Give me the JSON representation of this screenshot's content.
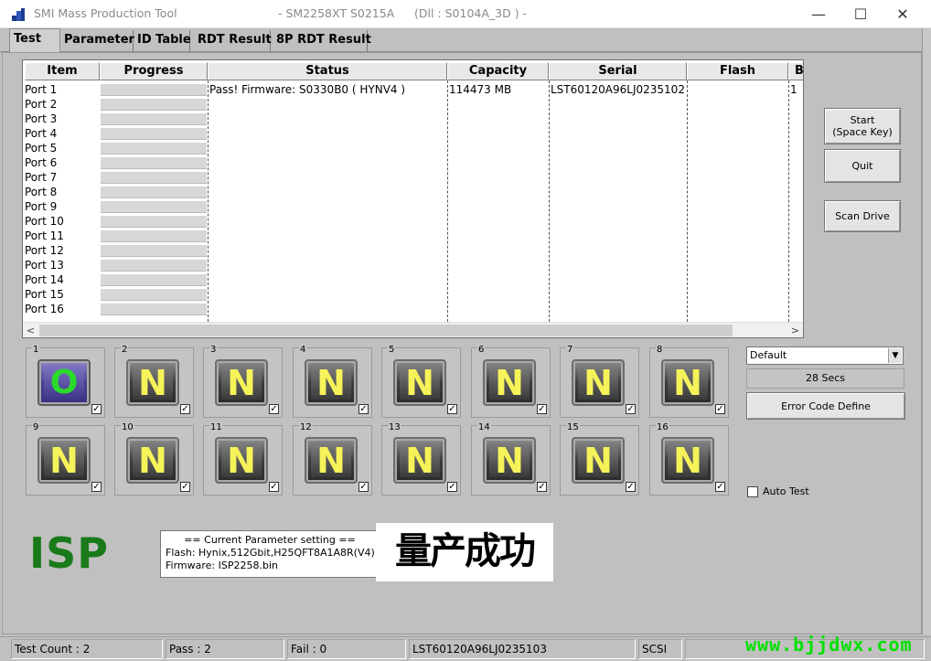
{
  "window": {
    "title": "SMI Mass Production Tool",
    "model": "- SM2258XT    S0215A",
    "dll": "(Dll : S0104A_3D ) -",
    "minimize": "—",
    "maximize": "☐",
    "close": "✕"
  },
  "tabs": [
    "Test",
    "Parameter",
    "ID Table",
    "RDT Result",
    "8P RDT Result"
  ],
  "table": {
    "headers": [
      "Item",
      "Progress",
      "Status",
      "Capacity",
      "Serial",
      "Flash",
      "B"
    ],
    "ports": [
      "Port 1",
      "Port 2",
      "Port 3",
      "Port 4",
      "Port 5",
      "Port 6",
      "Port 7",
      "Port 8",
      "Port 9",
      "Port 10",
      "Port 11",
      "Port 12",
      "Port 13",
      "Port 14",
      "Port 15",
      "Port 16"
    ],
    "row1": {
      "status": "Pass!  Firmware: S0330B0  ( HYNV4 )",
      "capacity": "114473 MB",
      "serial": "LST60120A96LJ0235102",
      "flash": "",
      "b": "1"
    },
    "scroll_left": "<",
    "scroll_right": ">"
  },
  "slots": [
    {
      "num": "1",
      "glyph": "O",
      "state": "pass"
    },
    {
      "num": "2",
      "glyph": "N",
      "state": "none"
    },
    {
      "num": "3",
      "glyph": "N",
      "state": "none"
    },
    {
      "num": "4",
      "glyph": "N",
      "state": "none"
    },
    {
      "num": "5",
      "glyph": "N",
      "state": "none"
    },
    {
      "num": "6",
      "glyph": "N",
      "state": "none"
    },
    {
      "num": "7",
      "glyph": "N",
      "state": "none"
    },
    {
      "num": "8",
      "glyph": "N",
      "state": "none"
    },
    {
      "num": "9",
      "glyph": "N",
      "state": "none"
    },
    {
      "num": "10",
      "glyph": "N",
      "state": "none"
    },
    {
      "num": "11",
      "glyph": "N",
      "state": "none"
    },
    {
      "num": "12",
      "glyph": "N",
      "state": "none"
    },
    {
      "num": "13",
      "glyph": "N",
      "state": "none"
    },
    {
      "num": "14",
      "glyph": "N",
      "state": "none"
    },
    {
      "num": "15",
      "glyph": "N",
      "state": "none"
    },
    {
      "num": "16",
      "glyph": "N",
      "state": "none"
    }
  ],
  "slot_checkmark": "✓",
  "buttons": {
    "start_line1": "Start",
    "start_line2": "(Space Key)",
    "quit": "Quit",
    "scan": "Scan Drive",
    "error_code": "Error Code Define"
  },
  "profile": {
    "selected": "Default",
    "arrow": "▼"
  },
  "timer": "28 Secs",
  "auto_test": "Auto Test",
  "isp_label": "ISP",
  "param": {
    "title": "== Current Parameter setting ==",
    "flash": "Flash:   Hynix,512Gbit,H25QFT8A1A8R(V4)",
    "firmware": "Firmware:   ISP2258.bin"
  },
  "success_text": "量产成功",
  "status_bar": {
    "test_count": "Test Count : 2",
    "pass": "Pass : 2",
    "fail": "Fail : 0",
    "serial": "LST60120A96LJ0235103",
    "iface": "SCSI"
  },
  "watermark": "www.bjjdwx.com",
  "colors": {
    "isp_green": "#1a7a1a",
    "pass_green": "#2bdb2b",
    "n_yellow": "#f6f35a",
    "watermark": "#00e000"
  }
}
